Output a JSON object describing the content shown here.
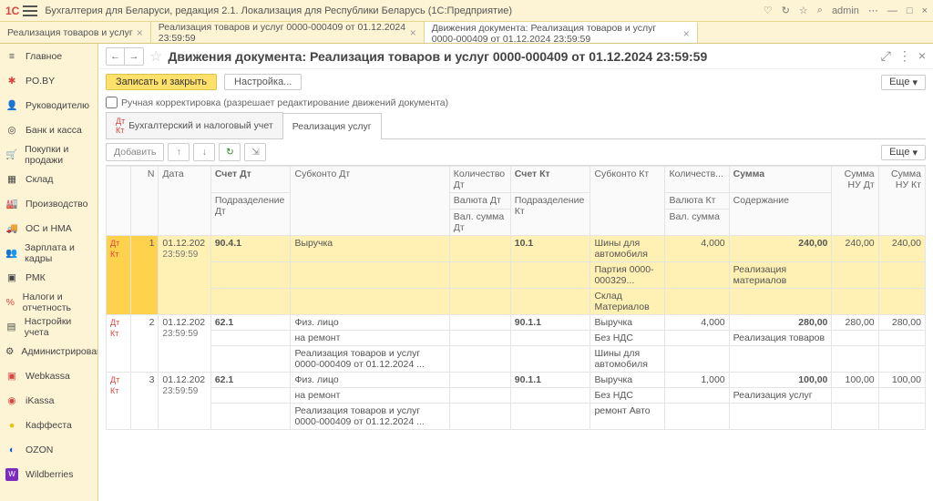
{
  "top": {
    "appTitle": "Бухгалтерия для Беларуси, редакция 2.1. Локализация для Республики Беларусь   (1С:Предприятие)",
    "user": "admin"
  },
  "tabs": {
    "t1": "Реализация товаров и услуг",
    "t2": "Реализация товаров и услуг 0000-000409 от 01.12.2024 23:59:59",
    "t3": "Движения документа: Реализация товаров и услуг 0000-000409 от 01.12.2024 23:59:59"
  },
  "side": {
    "main": "Главное",
    "poby": "PO.BY",
    "ruk": "Руководителю",
    "bank": "Банк и касса",
    "pokup": "Покупки и продажи",
    "sklad": "Склад",
    "proizv": "Производство",
    "os": "ОС и НМА",
    "zp": "Зарплата и кадры",
    "rmk": "РМК",
    "nalog": "Налоги и отчетность",
    "nast": "Настройки учета",
    "admin": "Администрирование",
    "web": "Webkassa",
    "ikassa": "iKassa",
    "kaf": "Каффеста",
    "ozon": "OZON",
    "wb": "Wildberries"
  },
  "doc": {
    "title": "Движения документа: Реализация товаров и услуг 0000-000409 от 01.12.2024 23:59:59",
    "saveClose": "Записать и закрыть",
    "settings": "Настройка...",
    "more": "Еще",
    "manual": "Ручная корректировка (разрешает редактирование движений документа)",
    "subtab1": "Бухгалтерский и налоговый учет",
    "subtab2": "Реализация услуг",
    "add": "Добавить"
  },
  "grid": {
    "h": {
      "n": "N",
      "date": "Дата",
      "schDt": "Счет Дт",
      "subDt": "Субконто Дт",
      "kolDt": "Количество Дт",
      "schKt": "Счет Кт",
      "subKt": "Субконто Кт",
      "kolKt": "Количеств...",
      "sum": "Сумма",
      "sumNuDt": "Сумма НУ Дт",
      "sumNuKt": "Сумма НУ Кт",
      "podrDt": "Подразделение Дт",
      "valDt": "Валюта Дт",
      "valSumDt": "Вал. сумма Дт",
      "podrKt": "Подразделение Кт",
      "valKt": "Валюта Кт",
      "valSumKt": "Вал.  сумма",
      "sod": "Содержание"
    },
    "rows": [
      {
        "n": "1",
        "date": "01.12.202",
        "time": "23:59:59",
        "schDt": "90.4.1",
        "subDt": "Выручка",
        "schKt": "10.1",
        "subKt1": "Шины для автомобиля",
        "subKt2": "Партия 0000-000329...",
        "subKt3": "Склад Материалов",
        "kolKt": "4,000",
        "sum": "240,00",
        "sumNuDt": "240,00",
        "sumNuKt": "240,00",
        "sod": "Реализация материалов"
      },
      {
        "n": "2",
        "date": "01.12.202",
        "time": "23:59:59",
        "schDt": "62.1",
        "subDt1": "Физ. лицо",
        "subDt2": "на ремонт",
        "subDt3": "Реализация товаров и услуг 0000-000409 от 01.12.2024 ...",
        "schKt": "90.1.1",
        "subKt1": "Выручка",
        "subKt2": "Без НДС",
        "subKt3": "Шины для автомобиля",
        "kolKt": "4,000",
        "sum": "280,00",
        "sumNuDt": "280,00",
        "sumNuKt": "280,00",
        "sod": "Реализация товаров"
      },
      {
        "n": "3",
        "date": "01.12.202",
        "time": "23:59:59",
        "schDt": "62.1",
        "subDt1": "Физ. лицо",
        "subDt2": "на ремонт",
        "subDt3": "Реализация товаров и услуг 0000-000409 от 01.12.2024 ...",
        "schKt": "90.1.1",
        "subKt1": "Выручка",
        "subKt2": "Без НДС",
        "subKt3": "ремонт Авто",
        "kolKt": "1,000",
        "sum": "100,00",
        "sumNuDt": "100,00",
        "sumNuKt": "100,00",
        "sod": "Реализация услуг"
      }
    ]
  }
}
